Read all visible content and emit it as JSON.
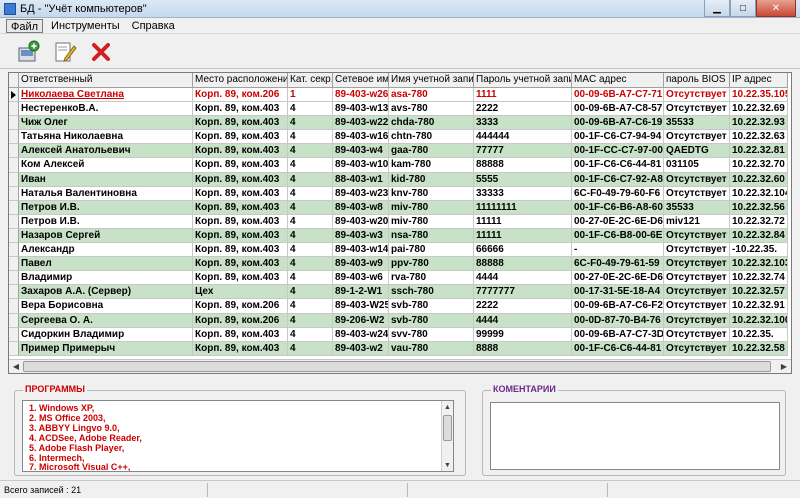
{
  "window": {
    "title": "БД - \"Учёт компьютеров\""
  },
  "menu": [
    {
      "label": "Файл",
      "active": true
    },
    {
      "label": "Инструменты",
      "active": false
    },
    {
      "label": "Справка",
      "active": false
    }
  ],
  "toolbar": {
    "icons": [
      "add-record-icon",
      "edit-record-icon",
      "delete-record-icon"
    ]
  },
  "table": {
    "columns": [
      "Ответственный",
      "Место расположения",
      "Кат. секр.",
      "Сетевое имя",
      "Имя учетной записи",
      "Пароль учетной записи",
      "MAC адрес",
      "пароль BIOS",
      "IP адрес"
    ],
    "rows": [
      [
        "Николаева Светлана",
        "Корп. 89, ком.206",
        "1",
        "89-403-w26",
        "asa-780",
        "1111",
        "00-09-6B-A7-C7-71",
        "Отсутствует",
        "10.22.35.105"
      ],
      [
        "НестеренкоВ.А.",
        "Корп. 89, ком.403",
        "4",
        "89-403-w13",
        "avs-780",
        "2222",
        "00-09-6B-A7-C8-57",
        "Отсутствует",
        "10.22.32.69"
      ],
      [
        "Чиж Олег",
        "Корп. 89, ком.403",
        "4",
        "89-403-w22",
        "chda-780",
        "3333",
        "00-09-6B-A7-C6-19",
        "35533",
        "10.22.32.93"
      ],
      [
        "Татьяна Николаевна",
        "Корп. 89, ком.403",
        "4",
        "89-403-w16",
        "chtn-780",
        "444444",
        "00-1F-C6-C7-94-94",
        "Отсутствует",
        "10.22.32.63"
      ],
      [
        "Алексей Анатольевич",
        "Корп. 89, ком.403",
        "4",
        "89-403-w4",
        "gaa-780",
        "77777",
        "00-1F-CC-C7-97-00",
        "QAEDTG",
        "10.22.32.81"
      ],
      [
        "Ком Алексей",
        "Корп. 89, ком.403",
        "4",
        "89-403-w10",
        "kam-780",
        "88888",
        "00-1F-C6-C6-44-81",
        "031105",
        "10.22.32.70"
      ],
      [
        "Иван",
        "Корп. 89, ком.403",
        "4",
        "88-403-w1",
        "kid-780",
        "5555",
        "00-1F-C6-C7-92-A8",
        "Отсутствует",
        "10.22.32.60"
      ],
      [
        "Наталья Валентиновна",
        "Корп. 89, ком.403",
        "4",
        "89-403-w23",
        "knv-780",
        "33333",
        "6C-F0-49-79-60-F6",
        "Отсутствует",
        "10.22.32.104"
      ],
      [
        "Петров И.В.",
        "Корп. 89, ком.403",
        "4",
        "89-403-w8",
        "miv-780",
        "11111111",
        "00-1F-C6-B6-A8-60",
        "35533",
        "10.22.32.56"
      ],
      [
        "Петров И.В.",
        "Корп. 89, ком.403",
        "4",
        "89-403-w20",
        "miv-780",
        "11111",
        "00-27-0E-2C-6E-D6",
        "miv121",
        "10.22.32.72"
      ],
      [
        "Назаров Сергей",
        "Корп. 89, ком.403",
        "4",
        "89-403-w3",
        "nsa-780",
        "11111",
        "00-1F-C6-B8-00-6E",
        "Отсутствует",
        "10.22.32.84"
      ],
      [
        "Александр",
        "Корп. 89, ком.403",
        "4",
        "89-403-w14",
        "pai-780",
        "66666",
        "-",
        "Отсутствует",
        "-10.22.35."
      ],
      [
        "Павел",
        "Корп. 89, ком.403",
        "4",
        "89-403-w9",
        "ppv-780",
        "88888",
        "6C-F0-49-79-61-59",
        "Отсутствует",
        "10.22.32.103"
      ],
      [
        "Владимир",
        "Корп. 89, ком.403",
        "4",
        "89-403-w6",
        "rva-780",
        "4444",
        "00-27-0E-2C-6E-D6",
        "Отсутствует",
        "10.22.32.74"
      ],
      [
        "Захаров А.А. (Сервер)",
        "Цех",
        "4",
        "89-1-2-W1",
        "ssch-780",
        "7777777",
        "00-17-31-5E-18-A4",
        "Отсутствует",
        "10.22.32.57"
      ],
      [
        "Вера Борисовна",
        "Корп. 89, ком.206",
        "4",
        "89-403-W25",
        "svb-780",
        "2222",
        "00-09-6B-A7-C6-F2",
        "Отсутствует",
        "10.22.32.91"
      ],
      [
        "Сергеева О. А.",
        "Корп. 89, ком.206",
        "4",
        "89-206-W2",
        "svb-780",
        "4444",
        "00-0D-87-70-B4-76",
        "Отсутствует",
        "10.22.32.100"
      ],
      [
        "Сидоркин Владимир",
        "Корп. 89, ком.403",
        "4",
        "89-403-w24",
        "svv-780",
        "99999",
        "00-09-6B-A7-C7-3D",
        "Отсутствует",
        "10.22.35."
      ],
      [
        "Пример Примерыч",
        "Корп. 89, ком.403",
        "4",
        "89-403-w2",
        "vau-780",
        "8888",
        "00-1F-C6-C6-44-81",
        "Отсутствует",
        "10.22.32.58"
      ]
    ]
  },
  "programs": {
    "title": "ПРОГРАММЫ",
    "items": [
      "1. Windows XP,",
      "2. MS Office 2003,",
      "3. ABBYY Lingvo 9.0,",
      "4. ACDSee, Adobe Reader,",
      "5. Adobe Flash Player,",
      "6. Intermech,",
      "7. Microsoft Visual C++,"
    ]
  },
  "comments": {
    "title": "КОМЕНТАРИИ",
    "text": ""
  },
  "status": {
    "records": "Всего записей : 21"
  },
  "colors": {
    "selected_text": "#cc0000",
    "alt_row": "#c8e2c8",
    "program_text": "#cc0000"
  }
}
